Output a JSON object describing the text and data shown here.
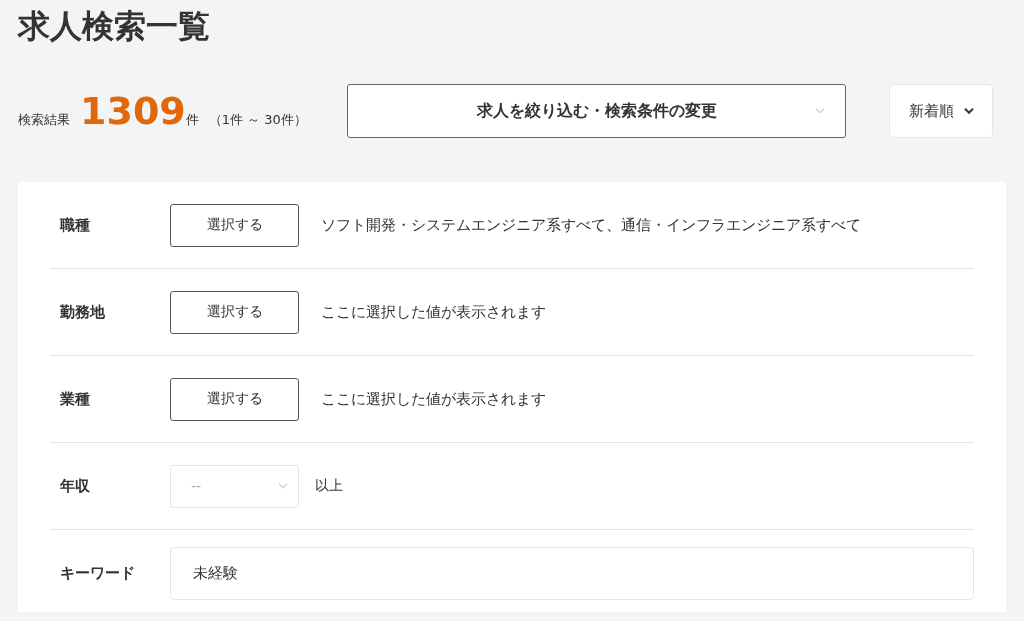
{
  "page": {
    "title": "求人検索一覧"
  },
  "results": {
    "label": "検索結果",
    "count": "1309",
    "unit": "件",
    "range": "（1件 ～ 30件）"
  },
  "filter_button": {
    "label": "求人を絞り込む・検索条件の変更"
  },
  "sort": {
    "value": "新着順"
  },
  "criteria": [
    {
      "kind": "picker",
      "label": "職種",
      "button": "選択する",
      "value": "ソフト開発・システムエンジニア系すべて、通信・インフラエンジニア系すべて"
    },
    {
      "kind": "picker",
      "label": "勤務地",
      "button": "選択する",
      "value": "ここに選択した値が表示されます"
    },
    {
      "kind": "picker",
      "label": "業種",
      "button": "選択する",
      "value": "ここに選択した値が表示されます"
    },
    {
      "kind": "dropdown",
      "label": "年収",
      "value": "--",
      "suffix": "以上"
    },
    {
      "kind": "text",
      "label": "キーワード",
      "value": "未経験"
    }
  ]
}
